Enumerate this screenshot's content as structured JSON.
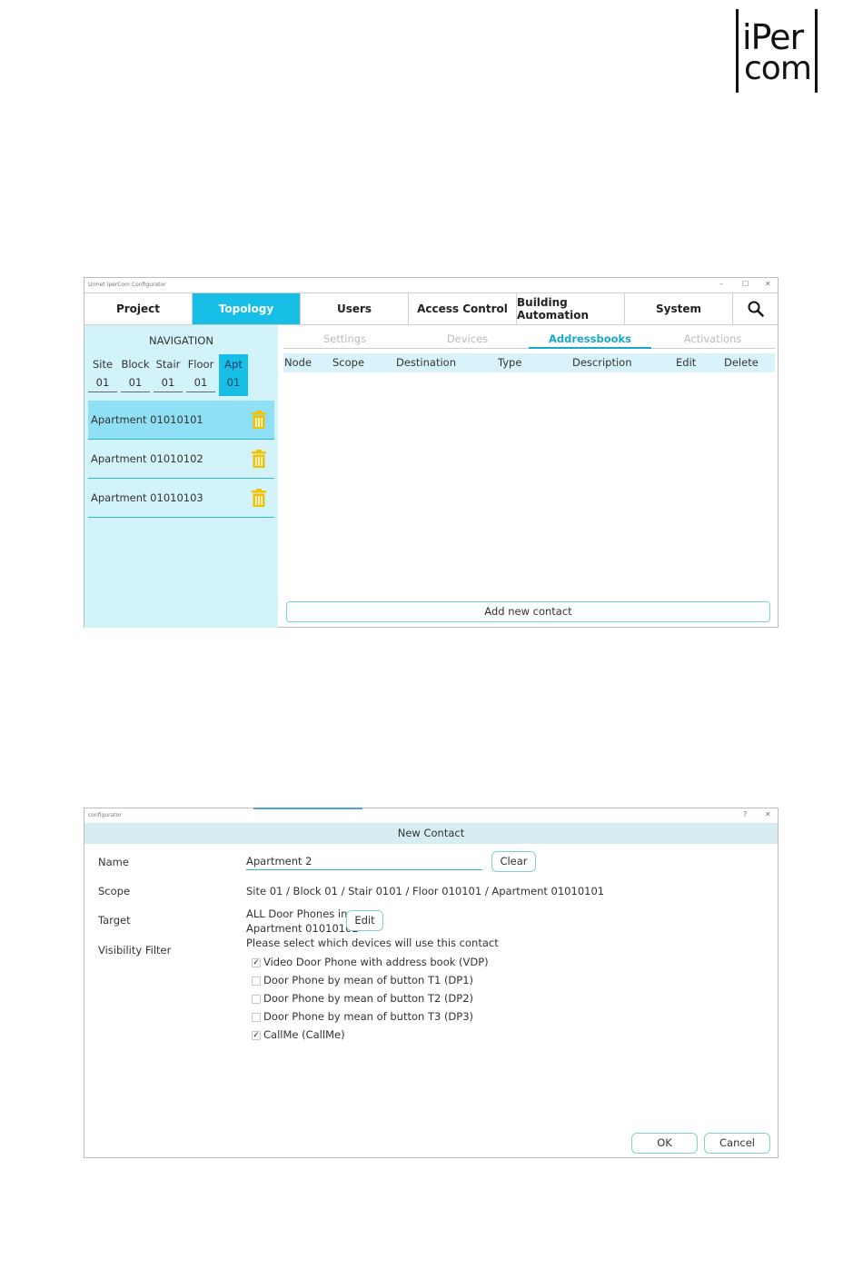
{
  "logo": {
    "line1": "iPer",
    "line2": "com"
  },
  "window1": {
    "title": "Urmet IperCom Configurator",
    "controls": [
      "–",
      "☐",
      "✕"
    ],
    "tabs": [
      "Project",
      "Topology",
      "Users",
      "Access Control",
      "Building Automation",
      "System"
    ],
    "active_tab": "Topology",
    "search_icon": "search-icon",
    "navigation": {
      "title": "NAVIGATION",
      "columns": [
        {
          "label": "Site",
          "value": "01"
        },
        {
          "label": "Block",
          "value": "01"
        },
        {
          "label": "Stair",
          "value": "01"
        },
        {
          "label": "Floor",
          "value": "01"
        },
        {
          "label": "Apt",
          "value": "01"
        }
      ],
      "apartments": [
        "Apartment 01010101",
        "Apartment 01010102",
        "Apartment 01010103"
      ],
      "delete_icon": "trash-icon"
    },
    "subtabs": [
      "Settings",
      "Devices",
      "Addressbooks",
      "Activations"
    ],
    "active_subtab": "Addressbooks",
    "table_headers": [
      "Node",
      "Scope",
      "Destination",
      "Type",
      "Description",
      "Edit",
      "Delete"
    ],
    "add_button": "Add new contact"
  },
  "window2": {
    "title": "configurator",
    "controls": [
      "?",
      "✕"
    ],
    "header": "New Contact",
    "name_label": "Name",
    "name_value": "Apartment 2",
    "clear_button": "Clear",
    "scope_label": "Scope",
    "scope_value": "Site 01 / Block 01 / Stair 0101 / Floor 010101 / Apartment 01010101",
    "target_label": "Target",
    "target_line1": "ALL Door Phones in",
    "target_line2": "Apartment 01010102",
    "edit_button": "Edit",
    "visibility_label": "Visibility Filter",
    "visibility_hint": "Please select which devices will use this contact",
    "filters": [
      {
        "label": "Video Door Phone with address book (VDP)",
        "checked": true
      },
      {
        "label": "Door Phone by mean of button T1 (DP1)",
        "checked": false
      },
      {
        "label": "Door Phone by mean of button T2 (DP2)",
        "checked": false
      },
      {
        "label": "Door Phone by mean of button T3 (DP3)",
        "checked": false
      },
      {
        "label": "CallMe (CallMe)",
        "checked": true
      }
    ],
    "ok_button": "OK",
    "cancel_button": "Cancel"
  },
  "colors": {
    "accent": "#17bfe6",
    "nav_bg": "#d3f3fb",
    "selected_row": "#8fe0f5",
    "trash": "#f2c200"
  }
}
